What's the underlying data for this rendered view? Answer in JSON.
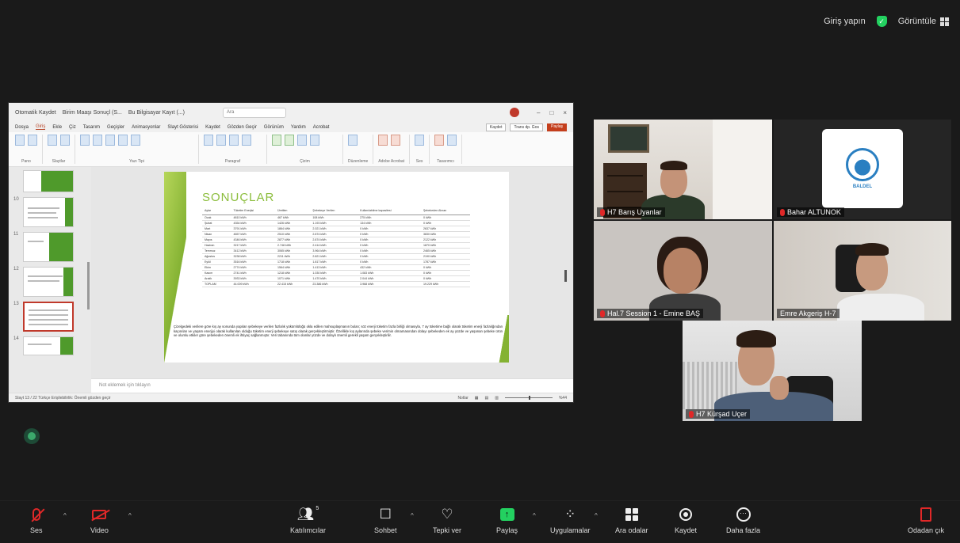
{
  "top_bar": {
    "login_label": "Giriş yapın",
    "view_label": "Görüntüle"
  },
  "powerpoint": {
    "title_items": [
      "Otomatik Kaydet",
      "Birim Maaşı Sonuçl (S...",
      "Bu Bilgisayar Kayıt (...)"
    ],
    "search_placeholder": "Ara",
    "menu_tabs": [
      "Dosya",
      "Giriş",
      "Ekle",
      "Çiz",
      "Tasarım",
      "Geçişler",
      "Animasyonlar",
      "Slayt Gösterisi",
      "Kaydet",
      "Gözden Geçir",
      "Görünüm",
      "Yardım",
      "Acrobat"
    ],
    "menu_right": [
      "Kaydet",
      "Trans dp. Gos",
      "Paylaş"
    ],
    "ribbon_groups": [
      "Pano",
      "Slaytlar",
      "Yazı Tipi",
      "Paragraf",
      "Çizim",
      "Düzenleme",
      "Adobe Acrobat",
      "Ses",
      "Tasarımcı"
    ],
    "thumbnail_numbers": [
      "",
      "10",
      "11",
      "12",
      "13",
      "14"
    ],
    "slide": {
      "title": "SONUÇLAR",
      "columns": [
        "Aylar",
        "Tüketim Enerjisi",
        "Üretilen",
        "Şebekeye Verilen",
        "Kullanılabilme kapasitesi",
        "Şebekeden Alınan"
      ],
      "rows": [
        [
          "Ocak",
          "4810 kWh",
          "467 kWh",
          "108 kWh",
          "275 kWh",
          "0 kWh"
        ],
        [
          "Şubat",
          "4354 kWh",
          "1426 kWh",
          "1.193 kWh",
          "134 kWh",
          "0 kWh"
        ],
        [
          "Mart",
          "3791 kWh",
          "1864 kWh",
          "2.021 kWh",
          "0 kWh",
          "2637 kWh"
        ],
        [
          "Nisan",
          "4657 kWh",
          "2510 kWh",
          "2.874 kWh",
          "0 kWh",
          "3830 kWh"
        ],
        [
          "Mayıs",
          "4346 kWh",
          "2877 kWh",
          "2.874 kWh",
          "0 kWh",
          "2122 kWh"
        ],
        [
          "Haziran",
          "3217 kWh",
          "2.748 kWh",
          "2.414 kWh",
          "0 kWh",
          "1870 kWh"
        ],
        [
          "Temmuz",
          "3412 kWh",
          "3065 kWh",
          "3.964 kWh",
          "0 kWh",
          "2465 kWh"
        ],
        [
          "Ağustos",
          "3238 kWh",
          "2211 kWh",
          "2.821 kWh",
          "0 kWh",
          "2190 kWh"
        ],
        [
          "Eylül",
          "3516 kWh",
          "1718 kWh",
          "1.817 kWh",
          "0 kWh",
          "1787 kWh"
        ],
        [
          "Ekim",
          "2774 kWh",
          "1564 kWh",
          "1.413 kWh",
          "432 kWh",
          "0 kWh"
        ],
        [
          "Kasım",
          "2741 kWh",
          "1218 kWh",
          "1.030 kWh",
          "1.083 kWh",
          "0 kWh"
        ],
        [
          "Aralık",
          "3933 kWh",
          "1071 kWh",
          "1.470 kWh",
          "2.044 kWh",
          "0 kWh"
        ],
        [
          "TOPLAM",
          "44.009 kWh",
          "22.415 kWh",
          "23.386 kWh",
          "3.968 kWh",
          "19.229 kWh"
        ]
      ],
      "paragraph": "Çizelgedeki verilere göre kış ay sonunda yapılan şebekeye verilen fazlalık yükümlülüğü okla edilen mahsuplaşmanın bulan; söz enerji tüketim fazla birliği olmasıyla, 7 ay tüketime bağlı olarak tüketim enerji fazlalığından kaçınılan ve yaşam enerjiyi olarak kullanılan olduğu tüketim enerji şebekeye satış olarak gerçekleştirmiştir. Özellikle kış aylarında şebeke verimin olmamasından dolayı şebekeden ek ay yüzde ve yaşanan şebeke ürün ve olumlu etkiler göre şebekeden önemli ek ihtiyaç sağlanmıştır. Veri tabanında tüm olanlar yüzde ve dolaylı önemli gerekli yaşam gerçekleştirilir."
    },
    "notes_placeholder": "Not eklemek için tıklayın",
    "status_left": "Slayt 13 / 22   Türkçe   Erişilebilirlik: Önemli gözden geçir",
    "status_right": "Notlar",
    "zoom": "%44"
  },
  "participants": [
    {
      "name": "H7 Barış Uyanlar"
    },
    {
      "name": "Bahar ALTUNOK",
      "logo_text": "BALDEL"
    },
    {
      "name": "Hal.7 Session 1 - Emine BAŞ"
    },
    {
      "name": "Emre Akgeriş H-7"
    },
    {
      "name": "H7 Kürşad Uçer"
    }
  ],
  "toolbar": {
    "mute": "Ses",
    "video": "Video",
    "participants": "Katılımcılar",
    "participants_count": "5",
    "chat": "Sohbet",
    "react": "Tepki ver",
    "share": "Paylaş",
    "apps": "Uygulamalar",
    "breakout": "Ara odalar",
    "record": "Kaydet",
    "more": "Daha fazla",
    "leave": "Odadan çık"
  },
  "colors": {
    "active_speaker": "#23d160",
    "muted": "#e02828",
    "slide_accent": "#8bbd3c"
  }
}
